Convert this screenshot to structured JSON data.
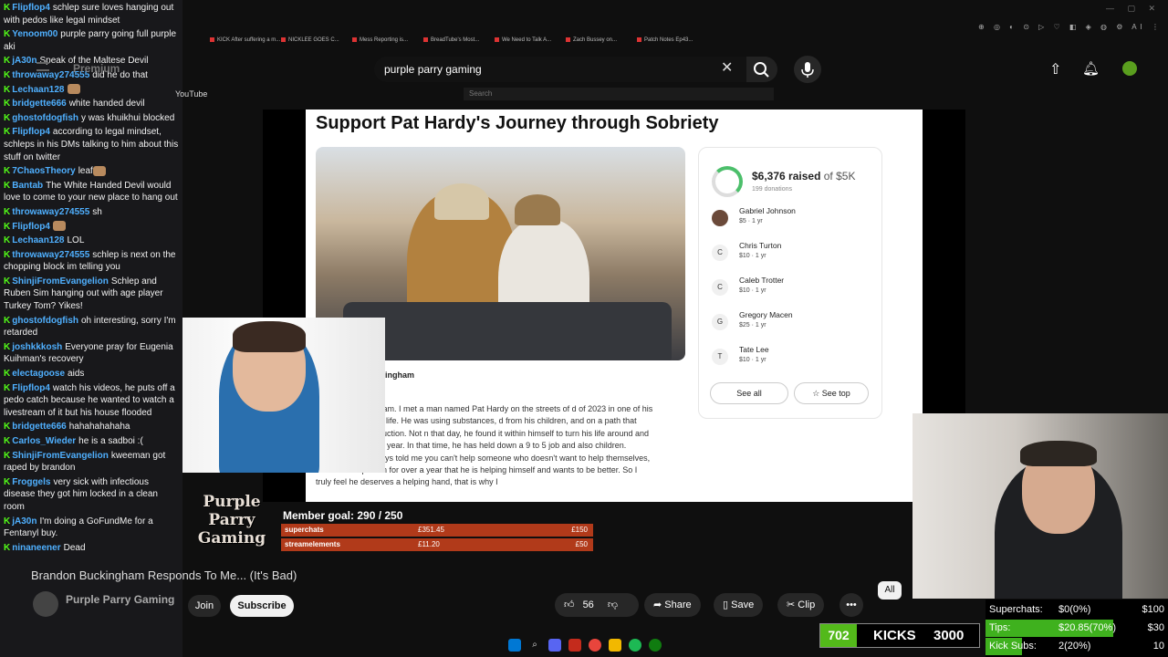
{
  "chat": [
    {
      "user": "Flipflop4",
      "color": "#4fb0ff",
      "message": "schlep sure loves hanging out with pedos like legal mindset"
    },
    {
      "user": "Yenoom00",
      "color": "#4fb0ff",
      "message": "purple parry going full purple aki"
    },
    {
      "user": "jA30n",
      "color": "#4fb0ff",
      "message": "Speak of the Maltese Devil"
    },
    {
      "user": "throwaway274555",
      "color": "#4fb0ff",
      "message": "did he do that"
    },
    {
      "user": "Lechaan128",
      "color": "#4fb0ff",
      "message": "",
      "emote": true
    },
    {
      "user": "bridgette666",
      "color": "#4fb0ff",
      "message": "white handed devil"
    },
    {
      "user": "ghostofdogfish",
      "color": "#4fb0ff",
      "message": "y was khuikhui blocked"
    },
    {
      "user": "Flipflop4",
      "color": "#4fb0ff",
      "message": "according to legal mindset, schleps in his DMs talking to him about this stuff on twitter"
    },
    {
      "user": "7ChaosTheory",
      "color": "#4fb0ff",
      "message": "leaf",
      "emote": true
    },
    {
      "user": "Bantab",
      "color": "#4fb0ff",
      "message": "The White Handed Devil would love to come to your new place to hang out"
    },
    {
      "user": "throwaway274555",
      "color": "#4fb0ff",
      "message": "sh"
    },
    {
      "user": "Flipflop4",
      "color": "#4fb0ff",
      "message": "",
      "emote": true
    },
    {
      "user": "Lechaan128",
      "color": "#4fb0ff",
      "message": "LOL"
    },
    {
      "user": "throwaway274555",
      "color": "#4fb0ff",
      "message": "schlep is next on the chopping block im telling you"
    },
    {
      "user": "ShinjiFromEvangelion",
      "color": "#4fb0ff",
      "message": "Schlep and Ruben Sim hanging out with age player Turkey Tom? Yikes!"
    },
    {
      "user": "ghostofdogfish",
      "color": "#4fb0ff",
      "message": "oh interesting, sorry I'm retarded"
    },
    {
      "user": "joshkkkosh",
      "color": "#4fb0ff",
      "message": "Everyone pray for Eugenia Kuihman's recovery"
    },
    {
      "user": "electagoose",
      "color": "#4fb0ff",
      "message": "aids"
    },
    {
      "user": "Flipflop4",
      "color": "#4fb0ff",
      "message": "watch his videos, he puts off a pedo catch because he wanted to watch a livestream of it but his house flooded"
    },
    {
      "user": "bridgette666",
      "color": "#4fb0ff",
      "message": "hahahahahaha"
    },
    {
      "user": "Carlos_Wieder",
      "color": "#4fb0ff",
      "message": "he is a sadboi :("
    },
    {
      "user": "ShinjiFromEvangelion",
      "color": "#4fb0ff",
      "message": "kweeman got raped by brandon"
    },
    {
      "user": "Froggels",
      "color": "#4fb0ff",
      "message": "very sick with infectious disease they got him locked in a clean room"
    },
    {
      "user": "jA30n",
      "color": "#4fb0ff",
      "message": "I'm doing a GoFundMe for a Fentanyl buy."
    },
    {
      "user": "ninaneener",
      "color": "#4fb0ff",
      "message": "Dead"
    }
  ],
  "browser_tabs": [
    "KICK After suffering a m...",
    "NICKLEE GOES C...",
    "Mess Reporting is...",
    "BreadTube's Most...",
    "We Need to Talk A...",
    "Zach Bussey on...",
    "Patch Notes Ep43..."
  ],
  "youtube": {
    "logo": "YouTube",
    "premium": "Premium",
    "search_value": "purple parry gaming",
    "mini_search_placeholder": "Search"
  },
  "gofundme": {
    "title": "Support Pat Hardy's Journey through Sobriety",
    "raised": "$6,376 raised",
    "goal": "of $5K",
    "donations": "199 donations",
    "donors": [
      {
        "initial": "",
        "name": "Gabriel Johnson",
        "amount": "$5 · 1 yr"
      },
      {
        "initial": "C",
        "name": "Chris Turton",
        "amount": "$10 · 1 yr"
      },
      {
        "initial": "C",
        "name": "Caleb Trotter",
        "amount": "$10 · 1 yr"
      },
      {
        "initial": "G",
        "name": "Gregory Macen",
        "amount": "$25 · 1 yr"
      },
      {
        "initial": "T",
        "name": "Tate Lee",
        "amount": "$10 · 1 yr"
      }
    ],
    "see_all": "See all",
    "see_top": "☆ See top",
    "organizer": "kingham",
    "story": "Brandon Buckingham. I met a man named Pat Hardy on the streets of d of 2023 in one of his lowest moments in life. He was using substances, d from his children, and on a path that only leads to destruction. Not n that day, he found it within himself to turn his life around and has ober for over a year. In that time, he has held down a 9 to 5 job and also children. Everyone has always told me you can't help someone who doesn't want to help themselves, and Pat has proven for over a year that he is helping himself and wants to be better. So I truly feel he deserves a helping hand, that is why I"
  },
  "overlay": {
    "logo_line1": "Purple",
    "logo_line2": "Parry",
    "logo_line3": "Gaming",
    "member_goal": "Member goal: 290 / 250",
    "superchats_label": "superchats",
    "superchats_value": "£351.45",
    "superchats_goal": "£150",
    "streamelements_label": "streamelements",
    "streamelements_value": "£11.20",
    "streamelements_goal": "£50"
  },
  "video": {
    "title": "Brandon Buckingham Responds To Me... (It's Bad)",
    "channel": "Purple Parry Gaming",
    "join": "Join",
    "subscribe": "Subscribe",
    "likes": "56",
    "share": "Share",
    "save": "Save",
    "clip": "Clip",
    "more": "•••",
    "all_chip": "All"
  },
  "kicks": {
    "count": "702",
    "label": "KICKS",
    "goal": "3000"
  },
  "stats": [
    {
      "label": "Superchats:",
      "value": "$0(0%)",
      "goal": "$100",
      "fill": 0,
      "color": "#000000"
    },
    {
      "label": "Tips:",
      "value": "$20.85(70%)",
      "goal": "$30",
      "fill": 0.7,
      "color": "#3fb11e"
    },
    {
      "label": "Kick Subs:",
      "value": "2(20%)",
      "goal": "10",
      "fill": 0.2,
      "color": "#3fb11e"
    }
  ],
  "colors": {
    "kick_green": "#53fc18",
    "youtube_bg": "#0f0f0f",
    "chat_bg": "#18181b"
  }
}
